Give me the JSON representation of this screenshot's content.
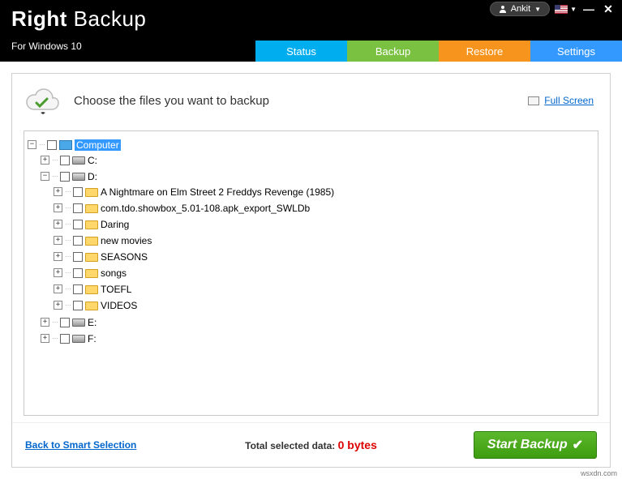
{
  "header": {
    "logo_bold": "Right",
    "logo_light": " Backup",
    "subtitle": "For Windows 10",
    "user_label": "Ankit"
  },
  "tabs": {
    "status": "Status",
    "backup": "Backup",
    "restore": "Restore",
    "settings": "Settings"
  },
  "panel": {
    "heading": "Choose the files you want to backup",
    "fullscreen": "Full Screen"
  },
  "tree": {
    "root": "Computer",
    "c": "C:",
    "d": "D:",
    "d_children": [
      "A Nightmare on Elm Street 2 Freddys Revenge (1985)",
      "com.tdo.showbox_5.01-108.apk_export_SWLDb",
      "Daring",
      "new movies",
      "SEASONS",
      "songs",
      "TOEFL",
      "VIDEOS"
    ],
    "e": "E:",
    "f": "F:"
  },
  "footer": {
    "back_link": "Back to Smart Selection",
    "total_label": "Total selected data:",
    "total_value": "0 bytes",
    "start_button": "Start Backup"
  },
  "watermark": "wsxdn.com"
}
